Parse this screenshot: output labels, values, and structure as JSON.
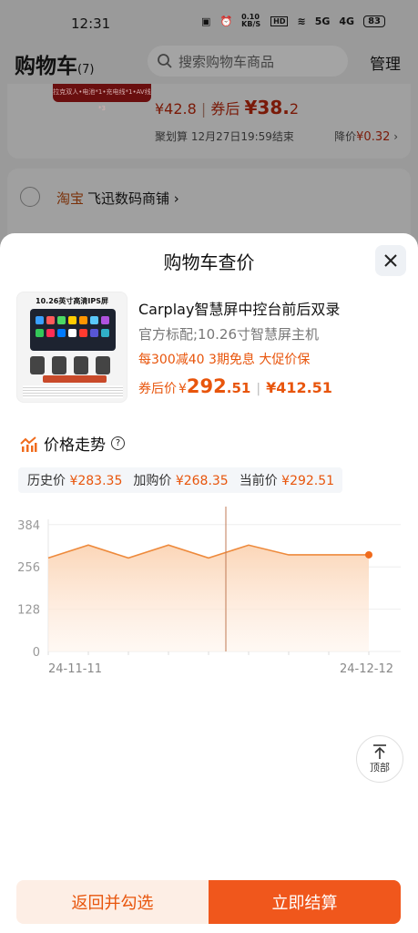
{
  "status_bar": {
    "time": "12:31",
    "net_speed": "0.10 KB/S",
    "hd": "HD",
    "signal1": "5G",
    "signal2": "4G",
    "battery": "83"
  },
  "header": {
    "title": "购物车",
    "count": "(7)",
    "search_placeholder": "搜索购物车商品",
    "manage": "管理"
  },
  "bg_card1": {
    "banner": "拉克双人•电池*1•充电线*1•AV线*3",
    "price_prefix": "¥42.8",
    "coupon_label": "券后",
    "coupon_price_int": "¥38.",
    "coupon_price_dec": "2",
    "promo_info": "聚划算 12月27日19:59结束",
    "drop_label": "降价",
    "drop_value": "¥0.32"
  },
  "bg_card2": {
    "platform": "淘宝",
    "shop": "飞迅数码商铺"
  },
  "sheet": {
    "title": "购物车查价",
    "product": {
      "thumb_title": "10.26英寸高清IPS屏",
      "name": "Carplay智慧屏中控台前后双录",
      "spec": "官方标配;10.26寸智慧屏主机",
      "promo": "每300减40 3期免息 大促价保",
      "coupon_label": "券后价",
      "price_currency": "¥",
      "price_int": "292",
      "price_dec": ".51",
      "orig_price": "¥412.51"
    },
    "trend_title": "价格走势",
    "stats": {
      "history_label": "历史价",
      "history_value": "¥283.35",
      "cart_label": "加购价",
      "cart_value": "¥268.35",
      "current_label": "当前价",
      "current_value": "¥292.51"
    },
    "back_to_top": "顶部",
    "btn_back": "返回并勾选",
    "btn_pay": "立即结算"
  },
  "chart_data": {
    "type": "area",
    "x_ticks": [
      "24-11-11",
      "24-12-12"
    ],
    "y_ticks": [
      0,
      128,
      256,
      384
    ],
    "ylim": [
      0,
      400
    ],
    "values": [
      283,
      322,
      283,
      322,
      283,
      322,
      292.51,
      292.51,
      292.51
    ],
    "colors": {
      "line": "#ee8a3c",
      "fill_top": "#fbd6b8",
      "fill_bottom": "#fff4ec",
      "marker": "#f06b1c",
      "cursor": "#c07a55"
    }
  }
}
